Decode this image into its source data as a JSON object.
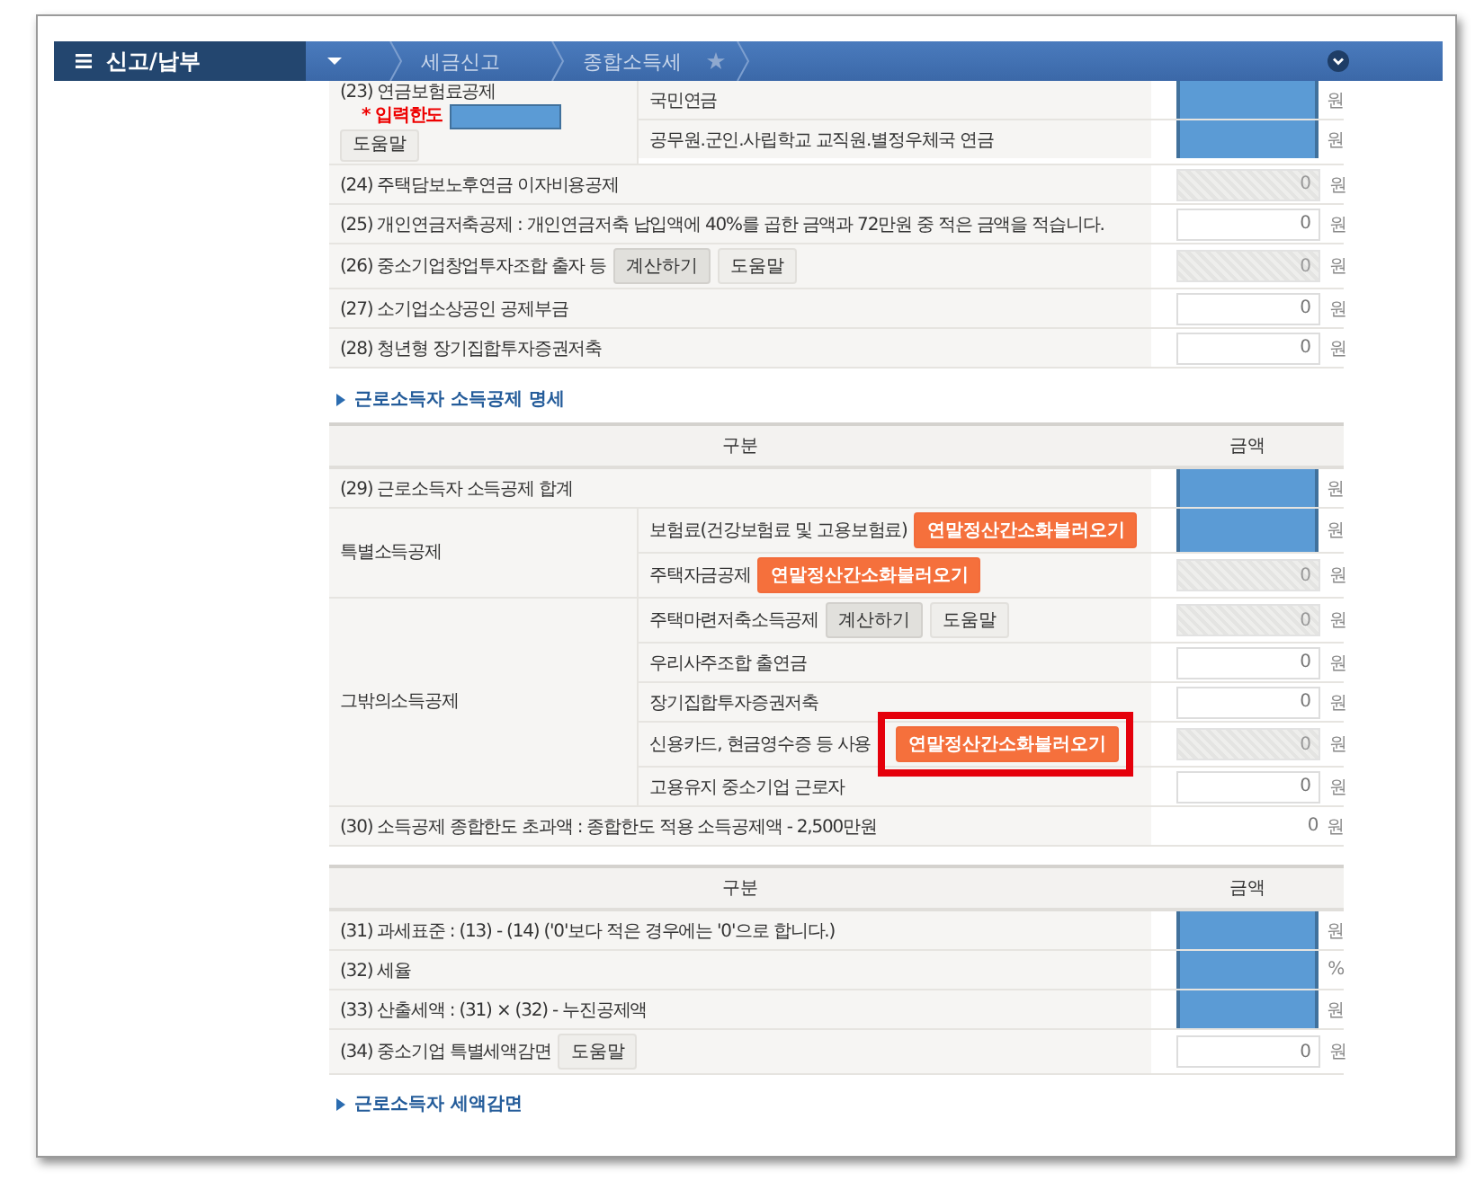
{
  "nav": {
    "title": "신고/납부",
    "breadcrumbs": [
      {
        "label": "세금신고"
      },
      {
        "label": "종합소득세"
      }
    ]
  },
  "section1": {
    "rows": [
      {
        "label": "(23) 연금보험료공제",
        "note": "* 입력한도",
        "note_redacted": true,
        "buttons": [
          {
            "label": "도움말",
            "kind": "help"
          }
        ],
        "subrows": [
          {
            "label": "국민연금",
            "amount": {
              "kind": "redacted",
              "unit": "원"
            }
          },
          {
            "label": "공무원.군인.사립학교 교직원.별정우체국 연금",
            "amount": {
              "kind": "redacted",
              "unit": "원"
            }
          }
        ]
      },
      {
        "label": "(24) 주택담보노후연금 이자비용공제",
        "amount": {
          "kind": "input",
          "value": "0",
          "disabled": true,
          "unit": "원"
        }
      },
      {
        "label": "(25) 개인연금저축공제 : 개인연금저축 납입액에 40%를 곱한 금액과 72만원 중 적은 금액을 적습니다.",
        "amount": {
          "kind": "input",
          "value": "0",
          "disabled": false,
          "unit": "원"
        }
      },
      {
        "label": "(26) 중소기업창업투자조합 출자 등",
        "buttons": [
          {
            "label": "계산하기",
            "kind": "calc"
          },
          {
            "label": "도움말",
            "kind": "help"
          }
        ],
        "amount": {
          "kind": "input",
          "value": "0",
          "disabled": true,
          "unit": "원"
        }
      },
      {
        "label": "(27) 소기업소상공인 공제부금",
        "amount": {
          "kind": "input",
          "value": "0",
          "disabled": false,
          "unit": "원"
        }
      },
      {
        "label": "(28) 청년형 장기집합투자증권저축",
        "amount": {
          "kind": "input",
          "value": "0",
          "disabled": false,
          "unit": "원"
        }
      }
    ]
  },
  "link1": {
    "label": "근로소득자 소득공제 명세"
  },
  "table2": {
    "columns": [
      "구분",
      "금액"
    ],
    "rows": [
      {
        "label": "(29) 근로소득자 소득공제 합계",
        "amount": {
          "kind": "redacted",
          "unit": "원"
        }
      },
      {
        "label": "특별소득공제",
        "subrows": [
          {
            "label": "보험료(건강보험료 및 고용보험료)",
            "buttons": [
              {
                "label": "연말정산간소화불러오기",
                "kind": "load",
                "highlighted": false
              }
            ],
            "amount": {
              "kind": "redacted",
              "unit": "원"
            }
          },
          {
            "label": "주택자금공제",
            "buttons": [
              {
                "label": "연말정산간소화불러오기",
                "kind": "load",
                "highlighted": false
              }
            ],
            "amount": {
              "kind": "input",
              "value": "0",
              "disabled": true,
              "unit": "원"
            }
          }
        ]
      },
      {
        "label": "그밖의소득공제",
        "subrows": [
          {
            "label": "주택마련저축소득공제",
            "buttons": [
              {
                "label": "계산하기",
                "kind": "calc"
              },
              {
                "label": "도움말",
                "kind": "help"
              }
            ],
            "amount": {
              "kind": "input",
              "value": "0",
              "disabled": true,
              "unit": "원"
            }
          },
          {
            "label": "우리사주조합 출연금",
            "amount": {
              "kind": "input",
              "value": "0",
              "disabled": false,
              "unit": "원"
            }
          },
          {
            "label": "장기집합투자증권저축",
            "amount": {
              "kind": "input",
              "value": "0",
              "disabled": false,
              "unit": "원"
            }
          },
          {
            "label": "신용카드, 현금영수증 등 사용",
            "buttons": [
              {
                "label": "연말정산간소화불러오기",
                "kind": "load",
                "highlighted": true
              }
            ],
            "amount": {
              "kind": "input",
              "value": "0",
              "disabled": true,
              "unit": "원"
            }
          },
          {
            "label": "고용유지 중소기업 근로자",
            "amount": {
              "kind": "input",
              "value": "0",
              "disabled": false,
              "unit": "원"
            }
          }
        ]
      },
      {
        "label": "(30) 소득공제 종합한도 초과액 : 종합한도 적용 소득공제액 - 2,500만원",
        "amount": {
          "kind": "text",
          "value": "0",
          "unit": "원"
        }
      }
    ]
  },
  "table3": {
    "columns": [
      "구분",
      "금액"
    ],
    "rows": [
      {
        "label": "(31) 과세표준 : (13) - (14) ('0'보다 적은 경우에는 '0'으로 합니다.)",
        "amount": {
          "kind": "redacted",
          "unit": "원"
        }
      },
      {
        "label": "(32) 세율",
        "amount": {
          "kind": "redacted",
          "unit": "%"
        }
      },
      {
        "label": "(33) 산출세액 : (31) × (32) - 누진공제액",
        "amount": {
          "kind": "redacted",
          "unit": "원"
        }
      },
      {
        "label": "(34) 중소기업 특별세액감면",
        "buttons": [
          {
            "label": "도움말",
            "kind": "help"
          }
        ],
        "amount": {
          "kind": "input",
          "value": "0",
          "disabled": false,
          "unit": "원"
        }
      }
    ]
  },
  "link2": {
    "label": "근로소득자 세액감면"
  }
}
